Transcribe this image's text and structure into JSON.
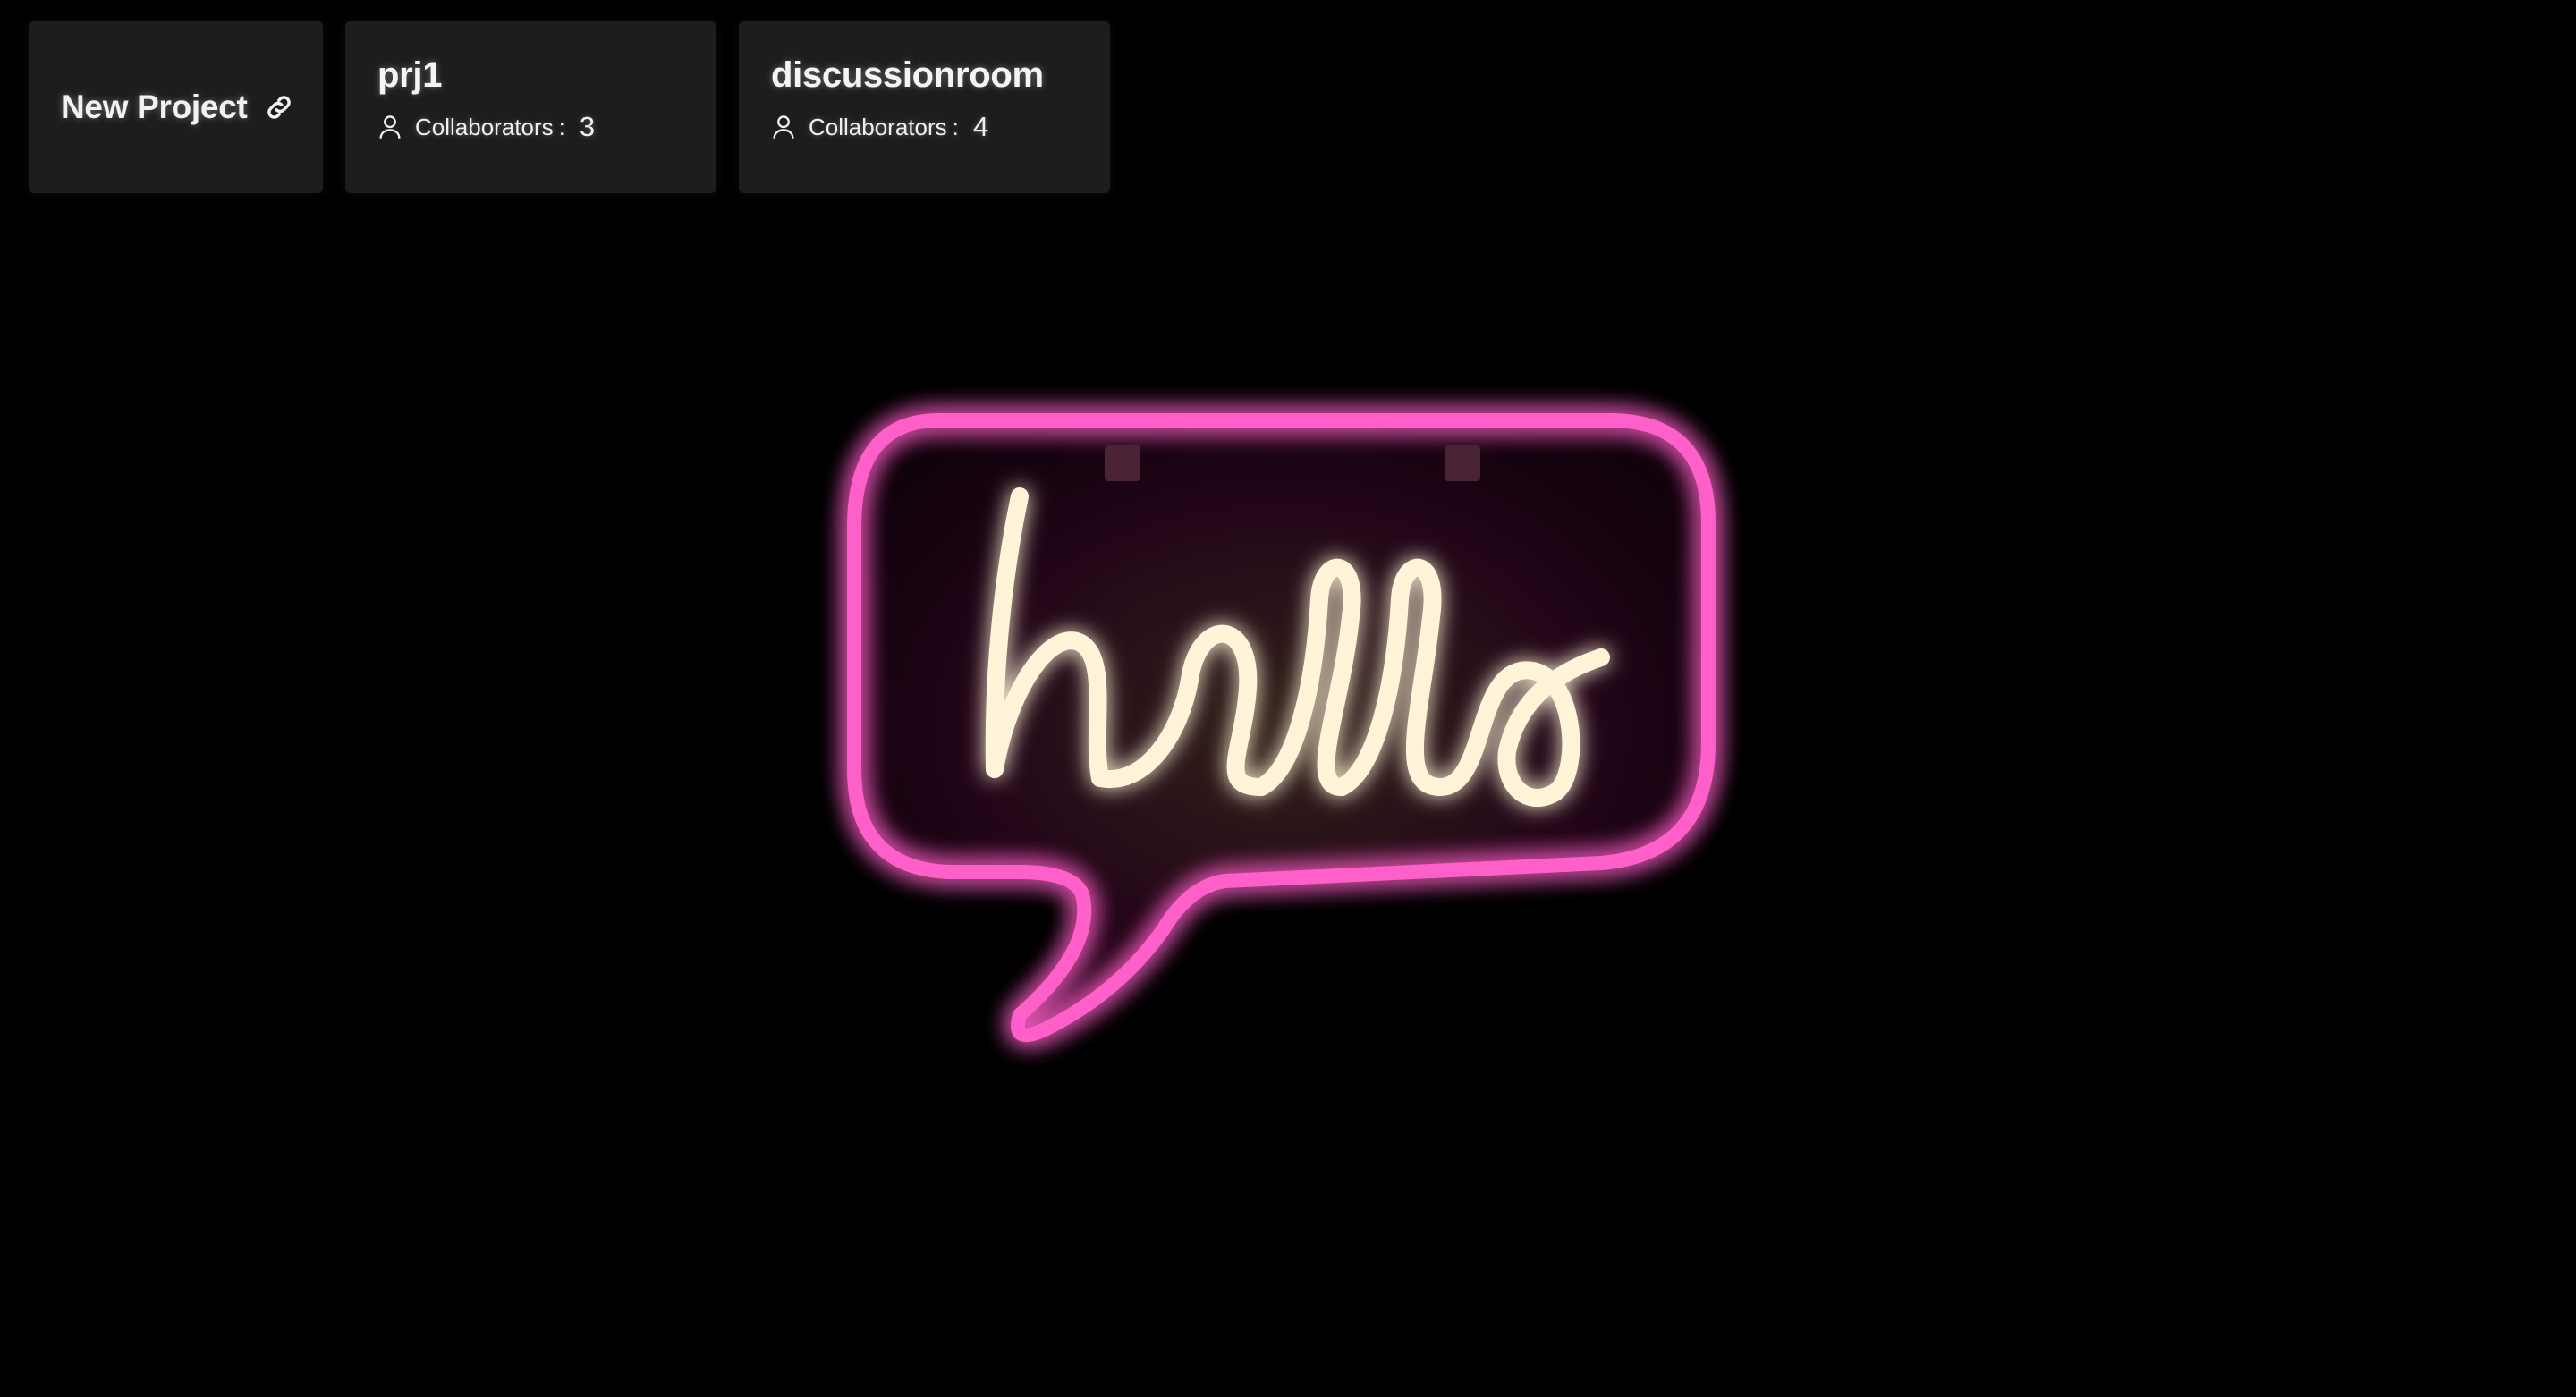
{
  "projects_bar": {
    "new_project": {
      "label": "New Project",
      "icon": "link-icon"
    },
    "projects": [
      {
        "name": "prj1",
        "collaborators_label": "Collaborators",
        "separator": ":",
        "collaborators_count": "3",
        "icon": "user-icon"
      },
      {
        "name": "discussionroom",
        "collaborators_label": "Collaborators",
        "separator": ":",
        "collaborators_count": "4",
        "icon": "user-icon"
      }
    ]
  },
  "background": {
    "neon_sign_text": "hello",
    "colors": {
      "page": "#000000",
      "card": "#1d1d1d",
      "neon_pink": "#ff4fc3",
      "neon_warm_white": "#fff6dc"
    }
  }
}
